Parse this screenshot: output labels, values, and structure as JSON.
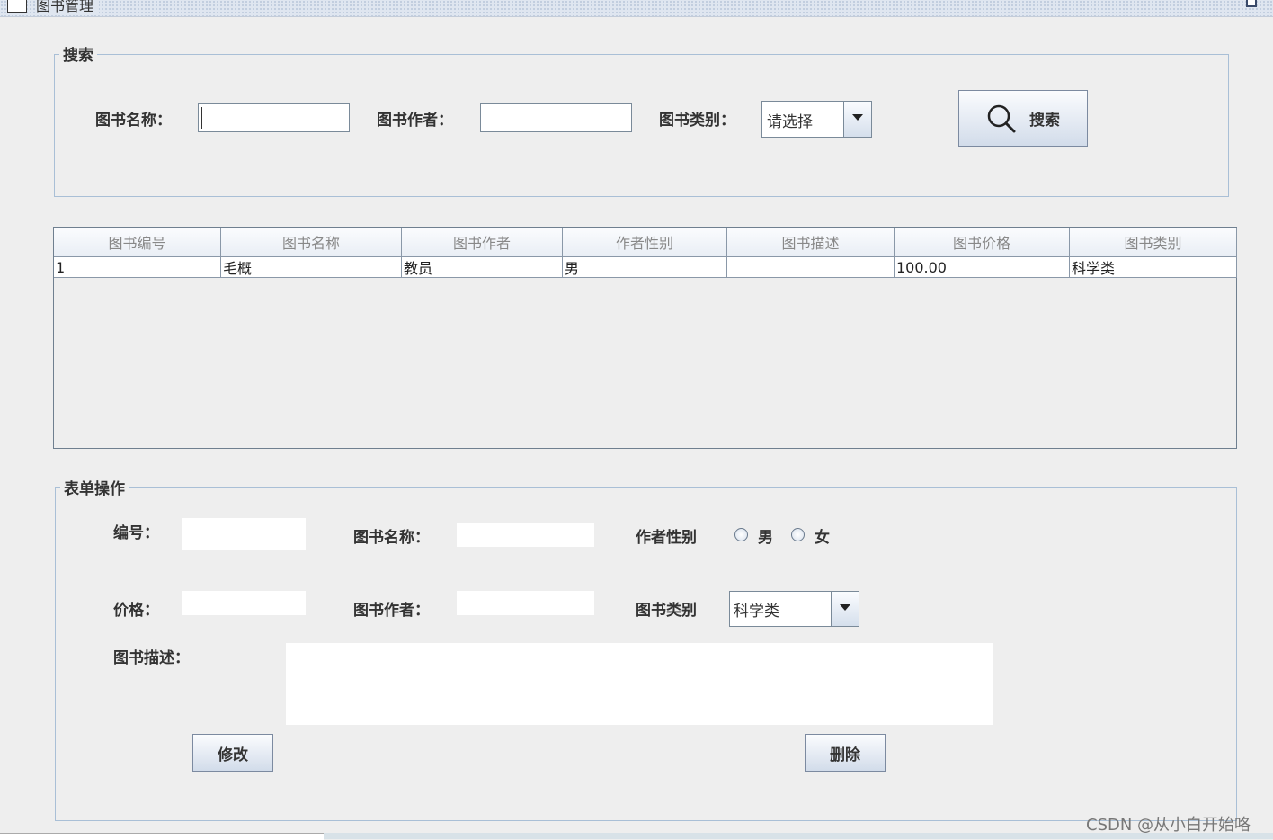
{
  "window": {
    "title": "图书管理"
  },
  "search": {
    "legend": "搜索",
    "book_name_label": "图书名称：",
    "book_name_value": "",
    "book_author_label": "图书作者：",
    "book_author_value": "",
    "book_type_label": "图书类别：",
    "book_type_selected": "请选择",
    "search_button_label": "搜索"
  },
  "table": {
    "columns": [
      "图书编号",
      "图书名称",
      "图书作者",
      "作者性别",
      "图书描述",
      "图书价格",
      "图书类别"
    ],
    "rows": [
      [
        "1",
        "毛概",
        "教员",
        "男",
        "",
        "100.00",
        "科学类"
      ]
    ]
  },
  "form": {
    "legend": "表单操作",
    "id_label": "编号：",
    "id_value": "",
    "book_name_label": "图书名称：",
    "book_name_value": "",
    "gender_label": "作者性别",
    "gender_options": [
      "男",
      "女"
    ],
    "price_label": "价格：",
    "price_value": "",
    "book_author_label": "图书作者：",
    "book_author_value": "",
    "book_type_label": "图书类别",
    "book_type_selected": "科学类",
    "desc_label": "图书描述：",
    "desc_value": "",
    "modify_button_label": "修改",
    "delete_button_label": "删除"
  },
  "watermark": "CSDN @从小白开始咯"
}
